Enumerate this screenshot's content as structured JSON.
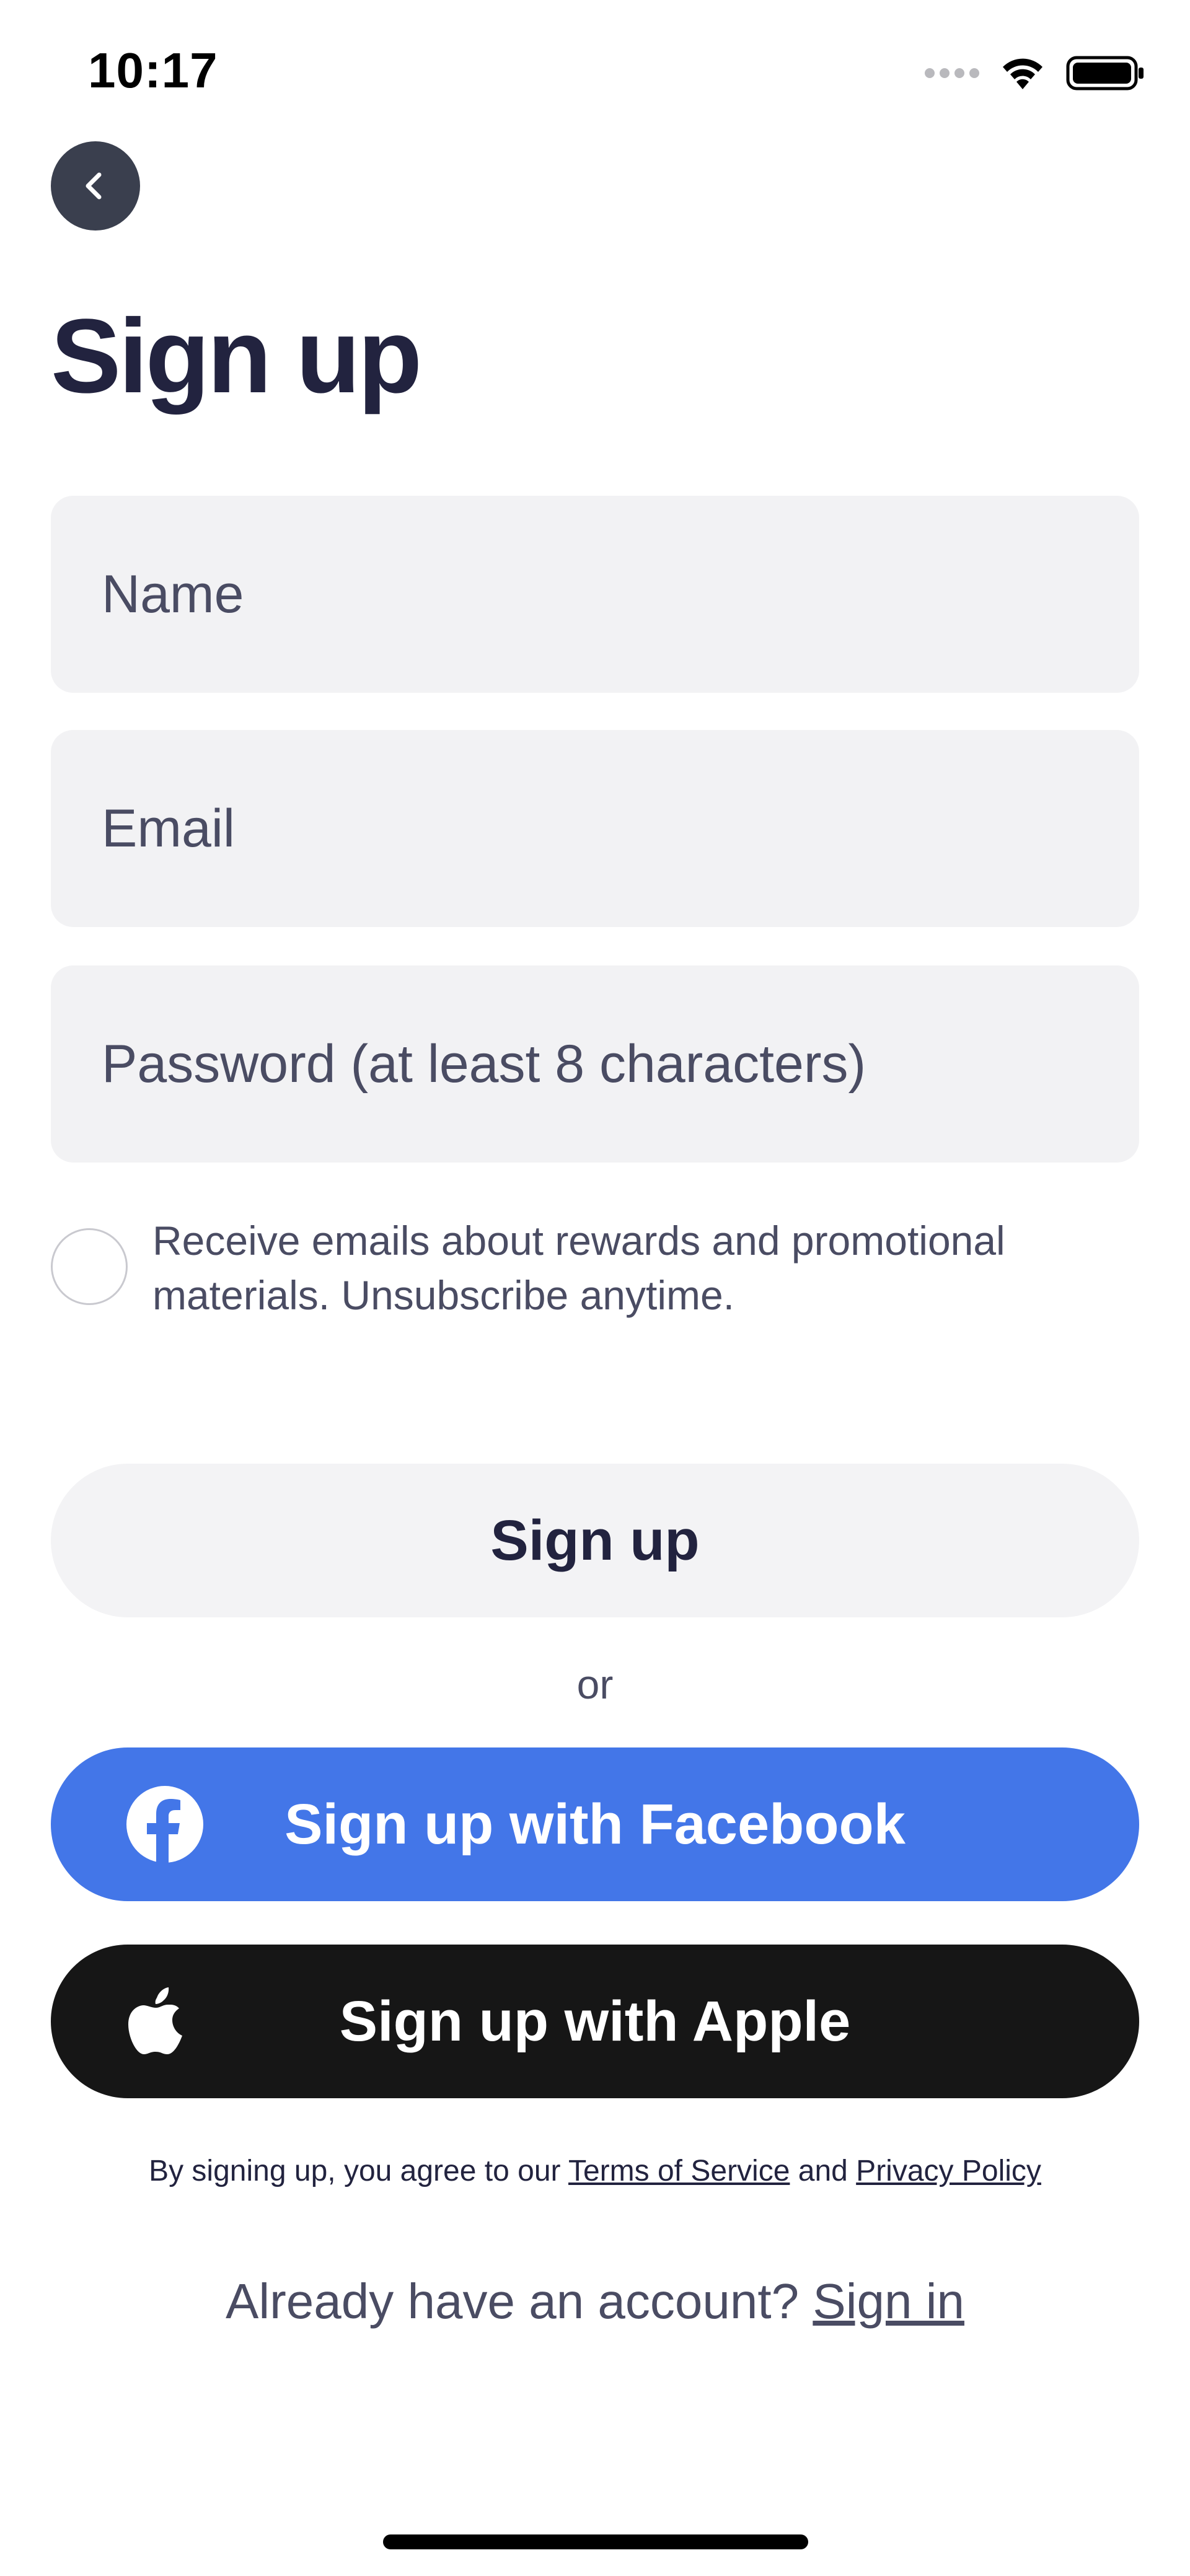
{
  "status_bar": {
    "time": "10:17"
  },
  "header": {
    "back_icon": "chevron-left-icon",
    "title": "Sign up"
  },
  "form": {
    "name_placeholder": "Name",
    "email_placeholder": "Email",
    "password_placeholder": "Password (at least 8 characters)",
    "marketing_opt_in": {
      "checked": false,
      "label": "Receive emails about rewards and promotional materials. Unsubscribe anytime."
    }
  },
  "actions": {
    "signup_label": "Sign up",
    "or_label": "or",
    "facebook_label": "Sign up with Facebook",
    "facebook_icon": "facebook-icon",
    "apple_label": "Sign up with Apple",
    "apple_icon": "apple-icon"
  },
  "legal": {
    "prefix": "By signing up, you agree to our ",
    "terms_label": "Terms of Service",
    "conjunction": " and ",
    "privacy_label": "Privacy Policy"
  },
  "signin": {
    "prompt": "Already have an account? ",
    "link_label": "Sign in"
  },
  "colors": {
    "facebook": "#4376E8",
    "apple": "#161616",
    "title": "#22233F",
    "field_bg": "#F2F2F4"
  }
}
